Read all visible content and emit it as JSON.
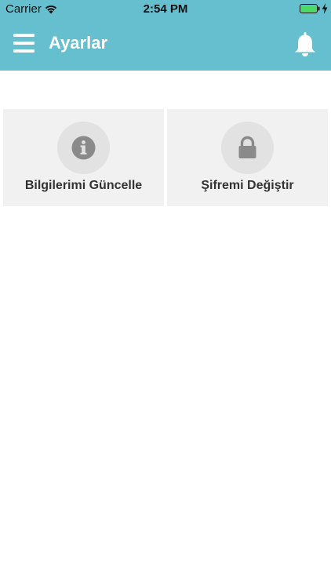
{
  "status_bar": {
    "carrier": "Carrier",
    "time": "2:54 PM",
    "battery_color": "#4cd964"
  },
  "header": {
    "title": "Ayarlar",
    "background_color": "#66bfce",
    "menu_icon": "hamburger-menu-icon",
    "notification_icon": "bell-icon"
  },
  "cards": [
    {
      "label": "Bilgilerimi Güncelle",
      "icon": "info-icon"
    },
    {
      "label": "Şifremi Değiştir",
      "icon": "lock-icon"
    }
  ]
}
